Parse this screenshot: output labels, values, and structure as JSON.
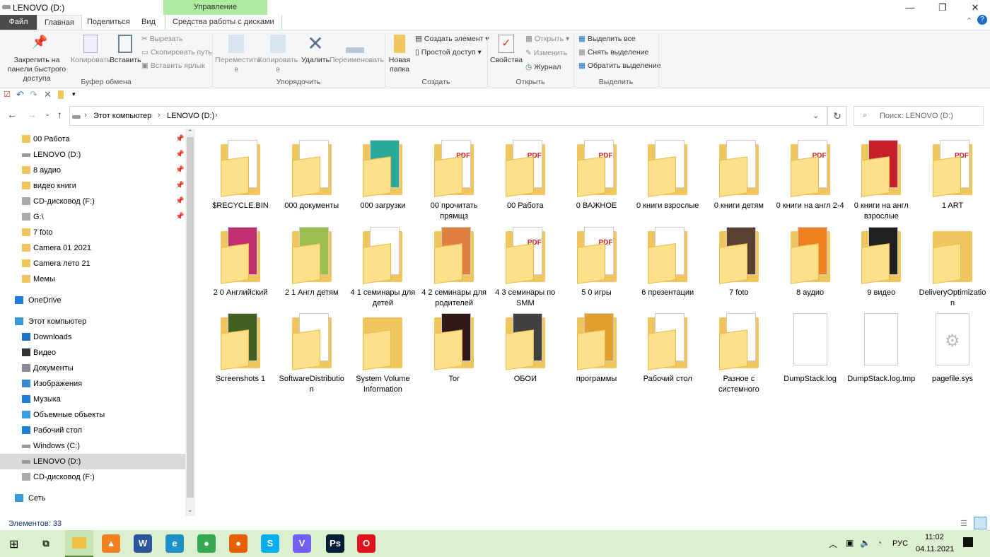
{
  "window": {
    "title": "LENOVO (D:)",
    "contextual_group": "Управление",
    "minimize": "—",
    "maximize": "❐",
    "close": "✕",
    "help": "?"
  },
  "tabs": [
    "Файл",
    "Главная",
    "Поделиться",
    "Вид",
    "Средства работы с дисками"
  ],
  "ribbon": {
    "clipboard": {
      "pin": "Закрепить на панели быстрого доступа",
      "copy": "Копировать",
      "paste": "Вставить",
      "cut": "Вырезать",
      "copy_path": "Скопировать путь",
      "paste_shortcut": "Вставить ярлык",
      "group": "Буфер обмена"
    },
    "organize": {
      "move": "Переместить в",
      "copyto": "Копировать в",
      "delete": "Удалить",
      "rename": "Переименовать",
      "group": "Упорядочить"
    },
    "create": {
      "new_folder": "Новая папка",
      "new_item": "Создать элемент",
      "easy_access": "Простой доступ",
      "group": "Создать"
    },
    "open": {
      "properties": "Свойства",
      "open": "Открыть",
      "edit": "Изменить",
      "history": "Журнал",
      "group": "Открыть"
    },
    "select": {
      "all": "Выделить все",
      "none": "Снять выделение",
      "invert": "Обратить выделение",
      "group": "Выделить"
    }
  },
  "address": {
    "crumbs": [
      "Этот компьютер",
      "LENOVO (D:)"
    ],
    "search_placeholder": "Поиск: LENOVO (D:)"
  },
  "sidebar": [
    {
      "label": "00 Работа",
      "icon": "folder",
      "pinned": true,
      "indent": 0
    },
    {
      "label": "LENOVO (D:)",
      "icon": "drive",
      "pinned": true,
      "indent": 0
    },
    {
      "label": "8 аудио",
      "icon": "folder",
      "pinned": true,
      "indent": 0
    },
    {
      "label": "видео книги",
      "icon": "folder",
      "pinned": true,
      "indent": 0
    },
    {
      "label": "CD-дисковод (F:)",
      "icon": "cd",
      "pinned": true,
      "indent": 0
    },
    {
      "label": "G:\\",
      "icon": "cd",
      "pinned": true,
      "indent": 0
    },
    {
      "label": "7 foto",
      "icon": "folder",
      "pinned": false,
      "indent": 0
    },
    {
      "label": "Camera 01 2021",
      "icon": "folder",
      "pinned": false,
      "indent": 0
    },
    {
      "label": "Camera лето 21",
      "icon": "folder",
      "pinned": false,
      "indent": 0
    },
    {
      "label": "Мемы",
      "icon": "folder",
      "pinned": false,
      "indent": 0
    },
    {
      "label": "OneDrive",
      "icon": "cloud",
      "pinned": false,
      "indent": -1,
      "gap": true
    },
    {
      "label": "Этот компьютер",
      "icon": "pc",
      "pinned": false,
      "indent": -1,
      "gap": true
    },
    {
      "label": "Downloads",
      "icon": "download",
      "pinned": false,
      "indent": 0
    },
    {
      "label": "Видео",
      "icon": "video",
      "pinned": false,
      "indent": 0
    },
    {
      "label": "Документы",
      "icon": "docs",
      "pinned": false,
      "indent": 0
    },
    {
      "label": "Изображения",
      "icon": "pictures",
      "pinned": false,
      "indent": 0
    },
    {
      "label": "Музыка",
      "icon": "music",
      "pinned": false,
      "indent": 0
    },
    {
      "label": "Объемные объекты",
      "icon": "3d",
      "pinned": false,
      "indent": 0
    },
    {
      "label": "Рабочий стол",
      "icon": "desktop",
      "pinned": false,
      "indent": 0
    },
    {
      "label": "Windows (C:)",
      "icon": "drive",
      "pinned": false,
      "indent": 0
    },
    {
      "label": "LENOVO (D:)",
      "icon": "drive",
      "pinned": false,
      "indent": 0,
      "selected": true
    },
    {
      "label": "CD-дисковод (F:)",
      "icon": "cd",
      "pinned": false,
      "indent": 0
    },
    {
      "label": "Сеть",
      "icon": "network",
      "pinned": false,
      "indent": -1,
      "gap": true
    }
  ],
  "items": [
    {
      "name": "$RECYCLE.BIN",
      "type": "folder-doc"
    },
    {
      "name": "000 документы",
      "type": "folder-doc"
    },
    {
      "name": "000 загрузки",
      "type": "folder-img",
      "color": "#2aa89a"
    },
    {
      "name": "00 прочитать прямщз",
      "type": "folder-pdf"
    },
    {
      "name": "00 Работа",
      "type": "folder-pdf"
    },
    {
      "name": "0 ВАЖНОЕ",
      "type": "folder-pdf"
    },
    {
      "name": "0 книги взрослые",
      "type": "folder-doc"
    },
    {
      "name": "0 книги детям",
      "type": "folder-doc"
    },
    {
      "name": "0 книги на англ 2-4",
      "type": "folder-pdf"
    },
    {
      "name": "0 книги на англ взрослые",
      "type": "folder-img",
      "color": "#c8202a"
    },
    {
      "name": "1 ART",
      "type": "folder-pdf"
    },
    {
      "name": "2 0 Английский",
      "type": "folder-img",
      "color": "#c03070"
    },
    {
      "name": "2 1 Англ детям",
      "type": "folder-img",
      "color": "#9cc050"
    },
    {
      "name": "4 1 семинары для детей",
      "type": "folder-doc"
    },
    {
      "name": "4 2 семинары для родителей",
      "type": "folder-img",
      "color": "#e08040"
    },
    {
      "name": "4 3 семинары по SMM",
      "type": "folder-pdf"
    },
    {
      "name": "5 0 игры",
      "type": "folder-pdf"
    },
    {
      "name": "6 презентации",
      "type": "folder-doc"
    },
    {
      "name": "7 foto",
      "type": "folder-img",
      "color": "#5a4030"
    },
    {
      "name": "8 аудио",
      "type": "folder-img",
      "color": "#f08020"
    },
    {
      "name": "9 видео",
      "type": "folder-img",
      "color": "#202020"
    },
    {
      "name": "DeliveryOptimization",
      "type": "folder"
    },
    {
      "name": "Screenshots 1",
      "type": "folder-img",
      "color": "#406020"
    },
    {
      "name": "SoftwareDistribution",
      "type": "folder-doc"
    },
    {
      "name": "System Volume Information",
      "type": "folder"
    },
    {
      "name": "Tor",
      "type": "folder-img",
      "color": "#301818"
    },
    {
      "name": "ОБОИ",
      "type": "folder-img",
      "color": "#404040"
    },
    {
      "name": "программы",
      "type": "folder-img",
      "color": "#e0a030"
    },
    {
      "name": "Рабочий стол",
      "type": "folder-doc"
    },
    {
      "name": "Разное с системного",
      "type": "folder-doc"
    },
    {
      "name": "DumpStack.log",
      "type": "file"
    },
    {
      "name": "DumpStack.log.tmp",
      "type": "file"
    },
    {
      "name": "pagefile.sys",
      "type": "file-sys"
    }
  ],
  "status": {
    "count": "Элементов: 33"
  },
  "taskbar": {
    "apps": [
      {
        "name": "task-view",
        "label": "⧉",
        "color": "transparent"
      },
      {
        "name": "explorer",
        "label": "",
        "color": "#f0c040"
      },
      {
        "name": "vlc",
        "label": "▲",
        "color": "#f08020"
      },
      {
        "name": "word",
        "label": "W",
        "color": "#2b579a"
      },
      {
        "name": "edge",
        "label": "e",
        "color": "#1e90c8"
      },
      {
        "name": "chrome",
        "label": "●",
        "color": "#34a853"
      },
      {
        "name": "firefox",
        "label": "●",
        "color": "#e66000"
      },
      {
        "name": "skype",
        "label": "S",
        "color": "#00aff0"
      },
      {
        "name": "viber",
        "label": "V",
        "color": "#7360f2"
      },
      {
        "name": "photoshop",
        "label": "Ps",
        "color": "#001e36"
      },
      {
        "name": "opera",
        "label": "O",
        "color": "#e0121e"
      }
    ],
    "lang": "РУС",
    "time": "11:02",
    "date": "04.11.2021"
  }
}
